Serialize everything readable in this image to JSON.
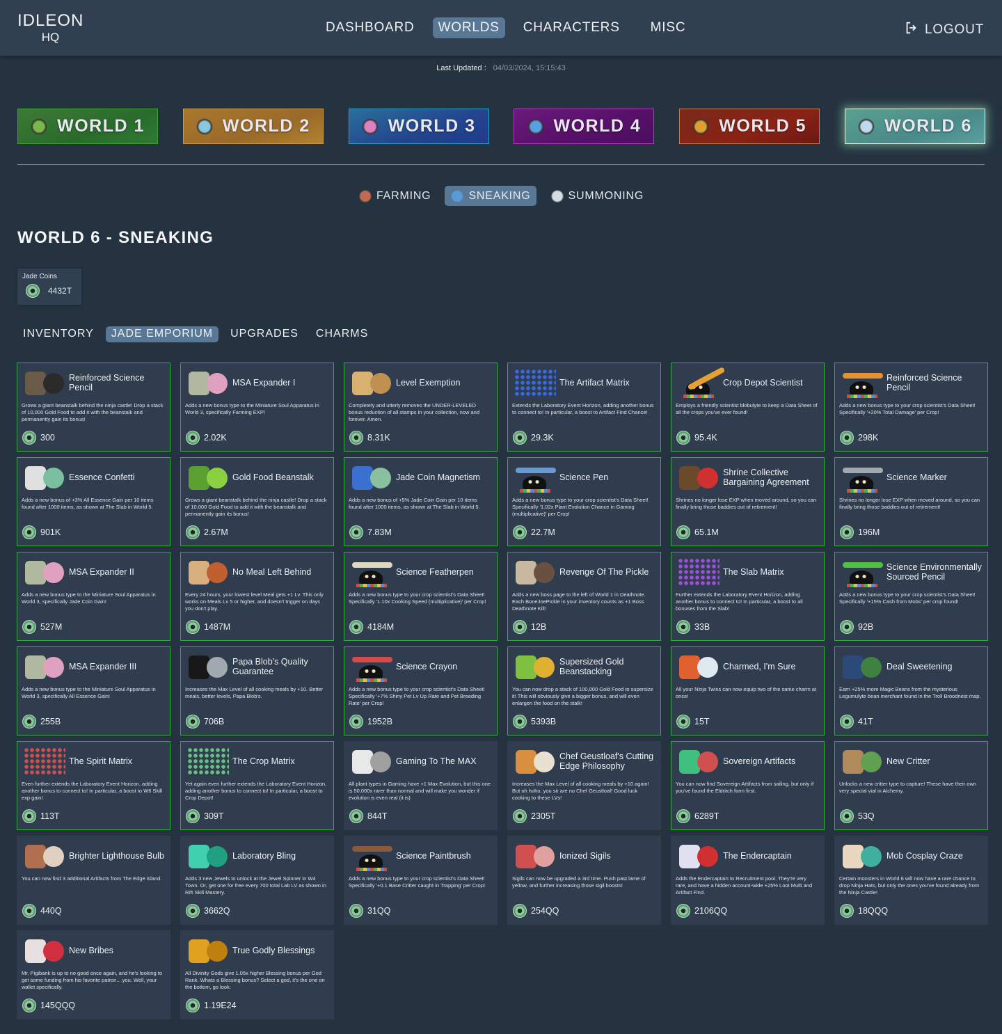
{
  "app": {
    "logo_line1": "IDLEON",
    "logo_line2": "HQ",
    "nav": [
      "DASHBOARD",
      "WORLDS",
      "CHARACTERS",
      "MISC"
    ],
    "nav_active": "WORLDS",
    "logout_label": "LOGOUT",
    "logout_icon": "logout-icon"
  },
  "last_updated": {
    "label": "Last Updated :",
    "value": "04/03/2024, 15:15:43"
  },
  "worlds": [
    {
      "label": "WORLD 1",
      "icon": "world-1-icon",
      "color": "#2f7a35"
    },
    {
      "label": "WORLD 2",
      "icon": "world-2-icon",
      "color": "#a9772c"
    },
    {
      "label": "WORLD 3",
      "icon": "world-3-icon",
      "color": "#23448f"
    },
    {
      "label": "WORLD 4",
      "icon": "world-4-icon",
      "color": "#561068"
    },
    {
      "label": "WORLD 5",
      "icon": "world-5-icon",
      "color": "#8a2216"
    },
    {
      "label": "WORLD 6",
      "icon": "world-6-icon",
      "color": "#4a8a8a",
      "active": true
    }
  ],
  "skill_tabs": [
    {
      "label": "FARMING",
      "icon": "farming-icon"
    },
    {
      "label": "SNEAKING",
      "icon": "sneaking-icon",
      "active": true
    },
    {
      "label": "SUMMONING",
      "icon": "summoning-icon"
    }
  ],
  "page_title": "WORLD 6 - SNEAKING",
  "jade_coins": {
    "label": "Jade Coins",
    "value": "4432T",
    "icon": "jade-coin-icon"
  },
  "section_tabs": [
    {
      "label": "INVENTORY"
    },
    {
      "label": "JADE EMPORIUM",
      "active": true
    },
    {
      "label": "UPGRADES"
    },
    {
      "label": "CHARMS"
    }
  ],
  "colors": {
    "owned_border": "#2fae3a",
    "active_tab": "#587895",
    "card_bg": "#2f3d4f",
    "page_bg": "#253341"
  },
  "emporium": [
    {
      "name": "Reinforced Science Pencil",
      "desc": "Grows a giant beanstalk behind the ninja castle! Drop a stack of 10,000 Gold Food to add it with the beanstalk and permanently gain its bonus!",
      "price": "300",
      "owned": true,
      "art": "sneaking-castle"
    },
    {
      "name": "MSA Expander I",
      "desc": "Adds a new bonus type to the Miniature Soul Apparatus in World 3, specifically Farming EXP!",
      "price": "2.02K",
      "owned": true,
      "art": "msa"
    },
    {
      "name": "Level Exemption",
      "desc": "Completely and utterly removes the UNDER-LEVELED bonus reduction of all stamps in your collection, now and forever. Amen.",
      "price": "8.31K",
      "owned": true,
      "art": "scroll"
    },
    {
      "name": "The Artifact Matrix",
      "desc": "Extends the Laboratory Event Horizon, adding another bonus to connect to! In particular, a boost to Artifact Find Chance!",
      "price": "29.3K",
      "owned": true,
      "art": "matrix-blue"
    },
    {
      "name": "Crop Depot Scientist",
      "desc": "Employs a friendly scientist blobulyte to keep a Data Sheet of all the crops you've ever found!",
      "price": "95.4K",
      "owned": true,
      "art": "scientist-pencil"
    },
    {
      "name": "Reinforced Science Pencil",
      "desc": "Adds a new bonus type to your crop scientist's Data Sheet! Specifically '+20% Total Damage' per Crop!",
      "price": "298K",
      "owned": true,
      "art": "scientist-orange"
    },
    {
      "name": "Essence Confetti",
      "desc": "Adds a new bonus of +3% All Essence Gain per 10 items found after 1000 items, as shown at The Slab in World 5.",
      "price": "901K",
      "owned": true,
      "art": "confetti"
    },
    {
      "name": "Gold Food Beanstalk",
      "desc": "Grows a giant beanstalk behind the ninja castle! Drop a stack of 10,000 Gold Food to add it with the beanstalk and permanently gain its bonus!",
      "price": "2.67M",
      "owned": true,
      "art": "beanstalk"
    },
    {
      "name": "Jade Coin Magnetism",
      "desc": "Adds a new bonus of +5% Jade Coin Gain per 10 items found after 1000 items, as shown at The Slab in World 5.",
      "price": "7.83M",
      "owned": true,
      "art": "magnet"
    },
    {
      "name": "Science Pen",
      "desc": "Adds a new bonus type to your crop scientist's Data Sheet! Specifically '1.02x Plant Evolution Chance in Gaming (multiplicative)' per Crop!",
      "price": "22.7M",
      "owned": true,
      "art": "scientist-blue"
    },
    {
      "name": "Shrine Collective Bargaining Agreement",
      "desc": "Shrines no longer lose EXP when moved around, so you can finally bring those baddies out of retirement!",
      "price": "65.1M",
      "owned": true,
      "art": "shrine"
    },
    {
      "name": "Science Marker",
      "desc": "Shrines no longer lose EXP when moved around, so you can finally bring those baddies out of retirement!",
      "price": "196M",
      "owned": true,
      "art": "scientist-grey"
    },
    {
      "name": "MSA Expander II",
      "desc": "Adds a new bonus type to the Miniature Soul Apparatus in World 3, specifically Jade Coin Gain!",
      "price": "527M",
      "owned": true,
      "art": "msa"
    },
    {
      "name": "No Meal Left Behind",
      "desc": "Every 24 hours, your lowest level Meal gets +1 Lv. This only works on Meals Lv 5 or higher, and doesn't trigger on days you don't play.",
      "price": "1487M",
      "owned": true,
      "art": "meal"
    },
    {
      "name": "Science Featherpen",
      "desc": "Adds a new bonus type to your crop scientist's Data Sheet! Specifically '1.10x Cooking Speed (multiplicative)' per Crop!",
      "price": "4184M",
      "owned": true,
      "art": "scientist-feather"
    },
    {
      "name": "Revenge Of The Pickle",
      "desc": "Adds a new boss page to the left of World 1 in Deathnote. Each BoneJoePickle in your inventory counts as +1 Boss Deathnote Kill!",
      "price": "12B",
      "owned": true,
      "art": "pickle"
    },
    {
      "name": "The Slab Matrix",
      "desc": "Further extends the Laboratory Event Horizon, adding another bonus to connect to! In particular, a boost to all bonuses from the Slab!",
      "price": "33B",
      "owned": true,
      "art": "matrix-purple"
    },
    {
      "name": "Science Environmentally Sourced Pencil",
      "desc": "Adds a new bonus type to your crop scientist's Data Sheet! Specifically '+15% Cash from Mobs' per crop found!",
      "price": "92B",
      "owned": true,
      "art": "scientist-green"
    },
    {
      "name": "MSA Expander III",
      "desc": "Adds a new bonus type to the Miniature Soul Apparatus in World 3, specifically All Essence Gain!",
      "price": "255B",
      "owned": true,
      "art": "msa"
    },
    {
      "name": "Papa Blob's Quality Guarantee",
      "desc": "Increases the Max Level of all cooking meals by +10. Better meals, better levels, Papa Blob's.",
      "price": "706B",
      "owned": true,
      "art": "papa-blob"
    },
    {
      "name": "Science Crayon",
      "desc": "Adds a new bonus type to your crop scientist's Data Sheet! Specifically '+7% Shiny Pet Lv Up Rate and Pet Breeding Rate' per Crop!",
      "price": "1952B",
      "owned": true,
      "art": "scientist-red"
    },
    {
      "name": "Supersized Gold Beanstacking",
      "desc": "You can now drop a stack of 100,000 Gold Food to supersize it! This will obviously give a bigger bonus, and will even enlargen the food on the stalk!",
      "price": "5393B",
      "owned": true,
      "art": "gold-bean"
    },
    {
      "name": "Charmed, I'm Sure",
      "desc": "All your Ninja Twins can now equip two of the same charm at once!",
      "price": "15T",
      "owned": true,
      "art": "charms"
    },
    {
      "name": "Deal Sweetening",
      "desc": "Earn +25% more Magic Beans from the mysterious Legumulyte bean merchant found in the Troll Broodnest map.",
      "price": "41T",
      "owned": true,
      "art": "bean-merchant"
    },
    {
      "name": "The Spirit Matrix",
      "desc": "Even further extends the Laboratory Event Horizon, adding another bonus to connect to! In particular, a boost to W6 Skill exp gain!",
      "price": "113T",
      "owned": true,
      "art": "matrix-red"
    },
    {
      "name": "The Crop Matrix",
      "desc": "Yet again even further extends the Laboratory Event Horizon, adding another bonus to connect to! In particular, a boost to Crop Depot!",
      "price": "309T",
      "owned": true,
      "art": "matrix-green"
    },
    {
      "name": "Gaming To The MAX",
      "desc": "All plant types in Gaming have +1 Max Evolution, but this one is 50,000x rarer than normal and will make you wonder if evolution is even real (it is)",
      "price": "844T",
      "owned": false,
      "art": "plant-white"
    },
    {
      "name": "Chef Geustloaf's Cutting Edge Philosophy",
      "desc": "Increases the Max Level of all cooking meals by +10 again! But oh hoho, you sir are no Chef Geustloaf! Good luck cooking to these LVs!",
      "price": "2305T",
      "owned": false,
      "art": "bread"
    },
    {
      "name": "Sovereign Artifacts",
      "desc": "You can now find Sovereign Artifacts from sailing, but only if you've found the Eldritch form first.",
      "price": "6289T",
      "owned": true,
      "art": "artifacts"
    },
    {
      "name": "New Critter",
      "desc": "Unlocks a new critter type to capture! These have their own very special vial in Alchemy.",
      "price": "53Q",
      "owned": true,
      "art": "critter"
    },
    {
      "name": "Brighter Lighthouse Bulb",
      "desc": "You can now find 3 additional Artifacts from The Edge island.",
      "price": "440Q",
      "owned": false,
      "art": "lighthouse"
    },
    {
      "name": "Laboratory Bling",
      "desc": "Adds 3 new Jewels to unlock at the Jewel Spinner in W4 Town. Or, get one for free every 700 total Lab LV as shown in Rift Skill Mastery.",
      "price": "3662Q",
      "owned": false,
      "art": "jewels"
    },
    {
      "name": "Science Paintbrush",
      "desc": "Adds a new bonus type to your crop scientist's Data Sheet! Specifically '+0.1 Base Critter caught in Trapping' per Crop!",
      "price": "31QQ",
      "owned": false,
      "art": "scientist-brush"
    },
    {
      "name": "Ionized Sigils",
      "desc": "Sigils can now be upgraded a 3rd time. Push past lame ol' yellow, and further increasing those sigil boosts!",
      "price": "254QQ",
      "owned": false,
      "art": "sigils"
    },
    {
      "name": "The Endercaptain",
      "desc": "Adds the Endercaptain to Recruitment pool. They're very rare, and have a hidden account-wide +25% Loot Multi and Artifact Find.",
      "price": "2106QQ",
      "owned": false,
      "art": "captain"
    },
    {
      "name": "Mob Cosplay Craze",
      "desc": "Certain monsters in World 6 will now have a rare chance to drop Ninja Hats, but only the ones you've found already from the Ninja Castle!",
      "price": "18QQQ",
      "owned": false,
      "art": "cosplay"
    },
    {
      "name": "New Bribes",
      "desc": "Mr. Pigibank is up to no good once again, and he's looking to get some funding from his favorite patron... you. Well, your wallet specifically.",
      "price": "145QQQ",
      "owned": false,
      "art": "bribes"
    },
    {
      "name": "True Godly Blessings",
      "desc": "All Divinity Gods give 1.05x higher Blessing bonus per God Rank. Whats a Blessing bonus? Select a god, it's the one on the bottom, go look.",
      "price": "1.19E24",
      "owned": false,
      "art": "god-rank"
    }
  ]
}
